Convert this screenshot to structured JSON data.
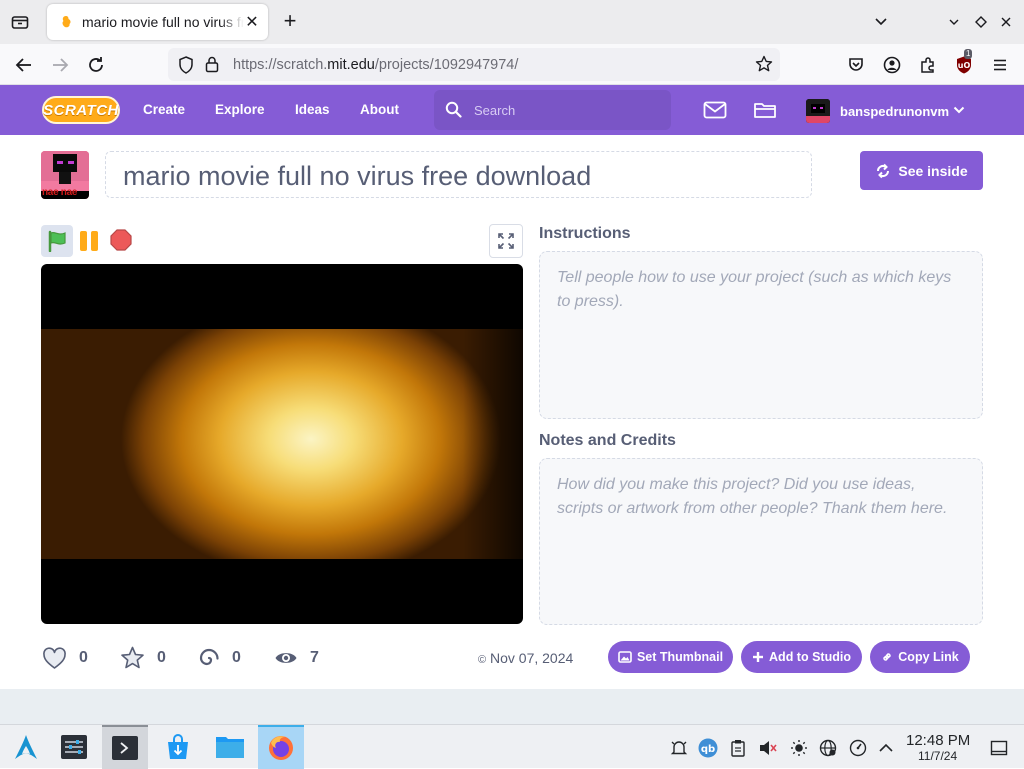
{
  "browser": {
    "tab_title": "mario movie full no virus free download - Scratch",
    "url_prefix": "https://scratch.",
    "url_domain": "mit.edu",
    "url_path": "/projects/1092947974/",
    "extension_badge": "1"
  },
  "scratch_nav": {
    "logo_text": "SCRATCH",
    "links": [
      "Create",
      "Explore",
      "Ideas",
      "About"
    ],
    "search_placeholder": "Search",
    "username": "banspedrunonvm"
  },
  "project": {
    "title": "mario movie full no virus free download",
    "see_inside_label": "See inside",
    "instructions_heading": "Instructions",
    "instructions_placeholder": "Tell people how to use your project (such as which keys to press).",
    "notes_heading": "Notes and Credits",
    "notes_placeholder": "How did you make this project? Did you use ideas, scripts or artwork from other people? Thank them here.",
    "stats": {
      "loves": "0",
      "favorites": "0",
      "remixes": "0",
      "views": "7"
    },
    "date": "Nov 07, 2024",
    "copyright_symbol": "©",
    "buttons": {
      "set_thumbnail": "Set Thumbnail",
      "add_to_studio": "Add to Studio",
      "copy_link": "Copy Link"
    },
    "thumbnail_text": "nae nae"
  },
  "taskbar": {
    "time": "12:48 PM",
    "date": "11/7/24"
  },
  "colors": {
    "scratch_purple": "#855cd6",
    "flag_green": "#4cbf56",
    "pause_orange": "#ffab19",
    "stop_red": "#ec5959"
  }
}
